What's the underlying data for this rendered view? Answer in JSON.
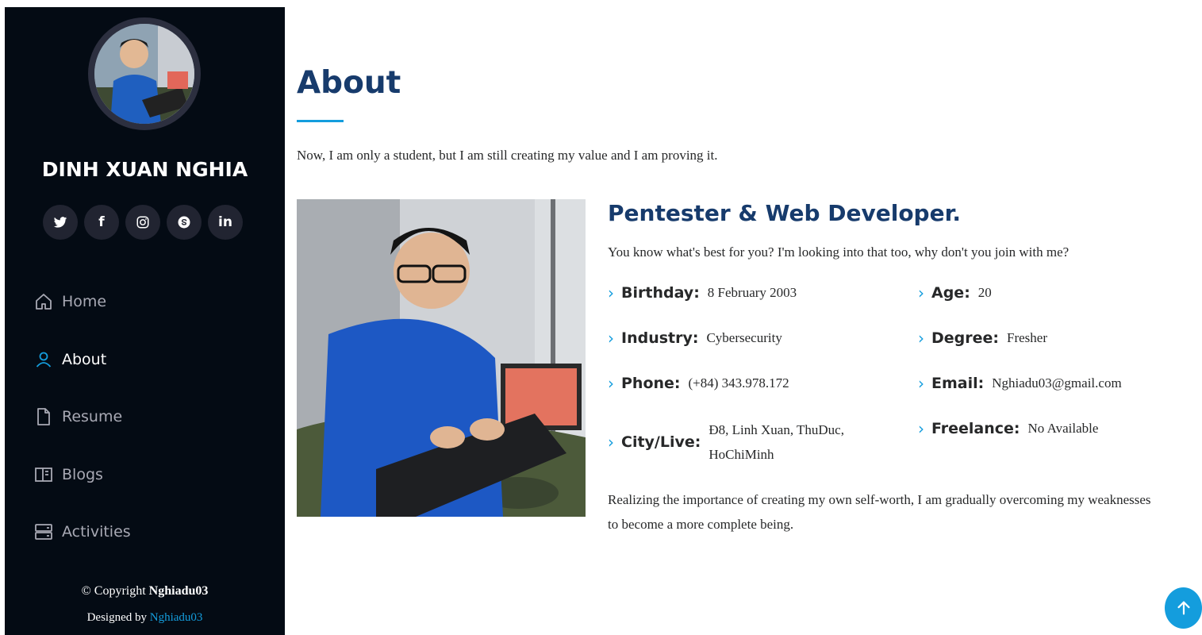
{
  "sidebar": {
    "name": "DINH XUAN NGHIA",
    "social": [
      {
        "icon": "twitter-icon",
        "glyph": ""
      },
      {
        "icon": "facebook-icon",
        "glyph": "f"
      },
      {
        "icon": "instagram-icon",
        "glyph": ""
      },
      {
        "icon": "skype-icon",
        "glyph": ""
      },
      {
        "icon": "linkedin-icon",
        "glyph": "in"
      }
    ],
    "nav": [
      {
        "label": "Home",
        "icon": "house-icon",
        "active": false
      },
      {
        "label": "About",
        "icon": "person-icon",
        "active": true
      },
      {
        "label": "Resume",
        "icon": "document-icon",
        "active": false
      },
      {
        "label": "Blogs",
        "icon": "book-icon",
        "active": false
      },
      {
        "label": "Activities",
        "icon": "server-icon",
        "active": false
      }
    ],
    "footer": {
      "copyright_prefix": "© Copyright ",
      "copyright_name": "Nghiadu03",
      "designed_prefix": "Designed by ",
      "designed_name": "Nghiadu03"
    }
  },
  "main": {
    "title": "About",
    "intro": "Now, I am only a student, but I am still creating my value and I am proving it.",
    "role_title": "Pentester & Web Developer.",
    "role_desc": "You know what's best for you? I'm looking into that too, why don't you join with me?",
    "facts": [
      {
        "label": "Birthday:",
        "value": "8 February 2003"
      },
      {
        "label": "Age:",
        "value": "20"
      },
      {
        "label": "Industry:",
        "value": "Cybersecurity"
      },
      {
        "label": "Degree:",
        "value": "Fresher"
      },
      {
        "label": "Phone:",
        "value": "(+84) 343.978.172"
      },
      {
        "label": "Email:",
        "value": "Nghiadu03@gmail.com"
      },
      {
        "label": "City/Live:",
        "value": "Đ8, Linh Xuan, ThuDuc, HoChiMinh"
      },
      {
        "label": "Freelance:",
        "value": "No Available"
      }
    ],
    "outro": "Realizing the importance of creating my own self-worth, I am gradually overcoming my weaknesses to become a more complete being."
  },
  "colors": {
    "sidebar_bg": "#040b14",
    "accent": "#149ddd",
    "heading": "#173b6c"
  }
}
